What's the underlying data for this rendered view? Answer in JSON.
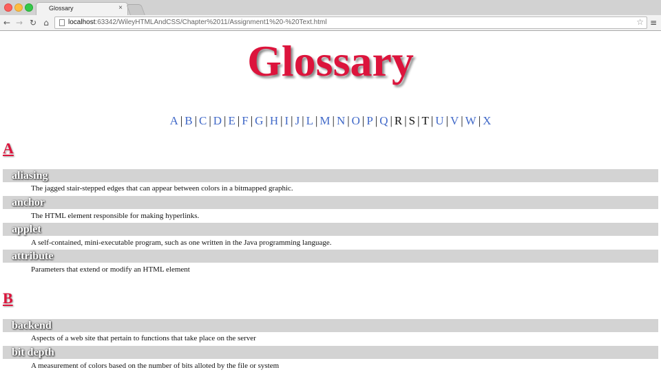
{
  "browser": {
    "tab_title": "Glossary",
    "tab_close": "×",
    "url_host": "localhost",
    "url_rest": ":63342/WileyHTMLAndCSS/Chapter%2011/Assignment1%20-%20Text.html",
    "icons": [
      "back-icon",
      "forward-icon",
      "reload-icon",
      "home-icon",
      "page-icon",
      "star-icon",
      "menu-icon"
    ]
  },
  "page": {
    "title": "Glossary",
    "colors": {
      "title": "#dc143c",
      "link": "#4169c8",
      "term_bar": "#d3d3d3",
      "term_text": "#ffffff"
    }
  },
  "alpha_nav": [
    {
      "label": "A",
      "linked": true
    },
    {
      "label": "B",
      "linked": true
    },
    {
      "label": "C",
      "linked": true
    },
    {
      "label": "D",
      "linked": true
    },
    {
      "label": "E",
      "linked": true
    },
    {
      "label": "F",
      "linked": true
    },
    {
      "label": "G",
      "linked": true
    },
    {
      "label": "H",
      "linked": true
    },
    {
      "label": "I",
      "linked": true
    },
    {
      "label": "J",
      "linked": true
    },
    {
      "label": "L",
      "linked": true
    },
    {
      "label": "M",
      "linked": true
    },
    {
      "label": "N",
      "linked": true
    },
    {
      "label": "O",
      "linked": true
    },
    {
      "label": "P",
      "linked": true
    },
    {
      "label": "Q",
      "linked": true
    },
    {
      "label": "R",
      "linked": false
    },
    {
      "label": "S",
      "linked": false
    },
    {
      "label": "T",
      "linked": false
    },
    {
      "label": "U",
      "linked": true
    },
    {
      "label": "V",
      "linked": true
    },
    {
      "label": "W",
      "linked": true
    },
    {
      "label": "X",
      "linked": true
    }
  ],
  "sections": [
    {
      "heading": "A",
      "entries": [
        {
          "term": "aliasing",
          "definition": "The jagged stair-stepped edges that can appear between colors in a bitmapped graphic."
        },
        {
          "term": "anchor",
          "definition": "The HTML element responsible for making hyperlinks."
        },
        {
          "term": "applet",
          "definition": "A self-contained, mini-executable program, such as one written in the Java programming language."
        },
        {
          "term": "attribute",
          "definition": "Parameters that extend or modify an HTML element"
        }
      ]
    },
    {
      "heading": "B",
      "entries": [
        {
          "term": "backend",
          "definition": "Aspects of a web site that pertain to functions that take place on the server"
        },
        {
          "term": "bit depth",
          "definition": "A measurement of colors based on the number of bits alloted by the file or system"
        }
      ]
    }
  ]
}
